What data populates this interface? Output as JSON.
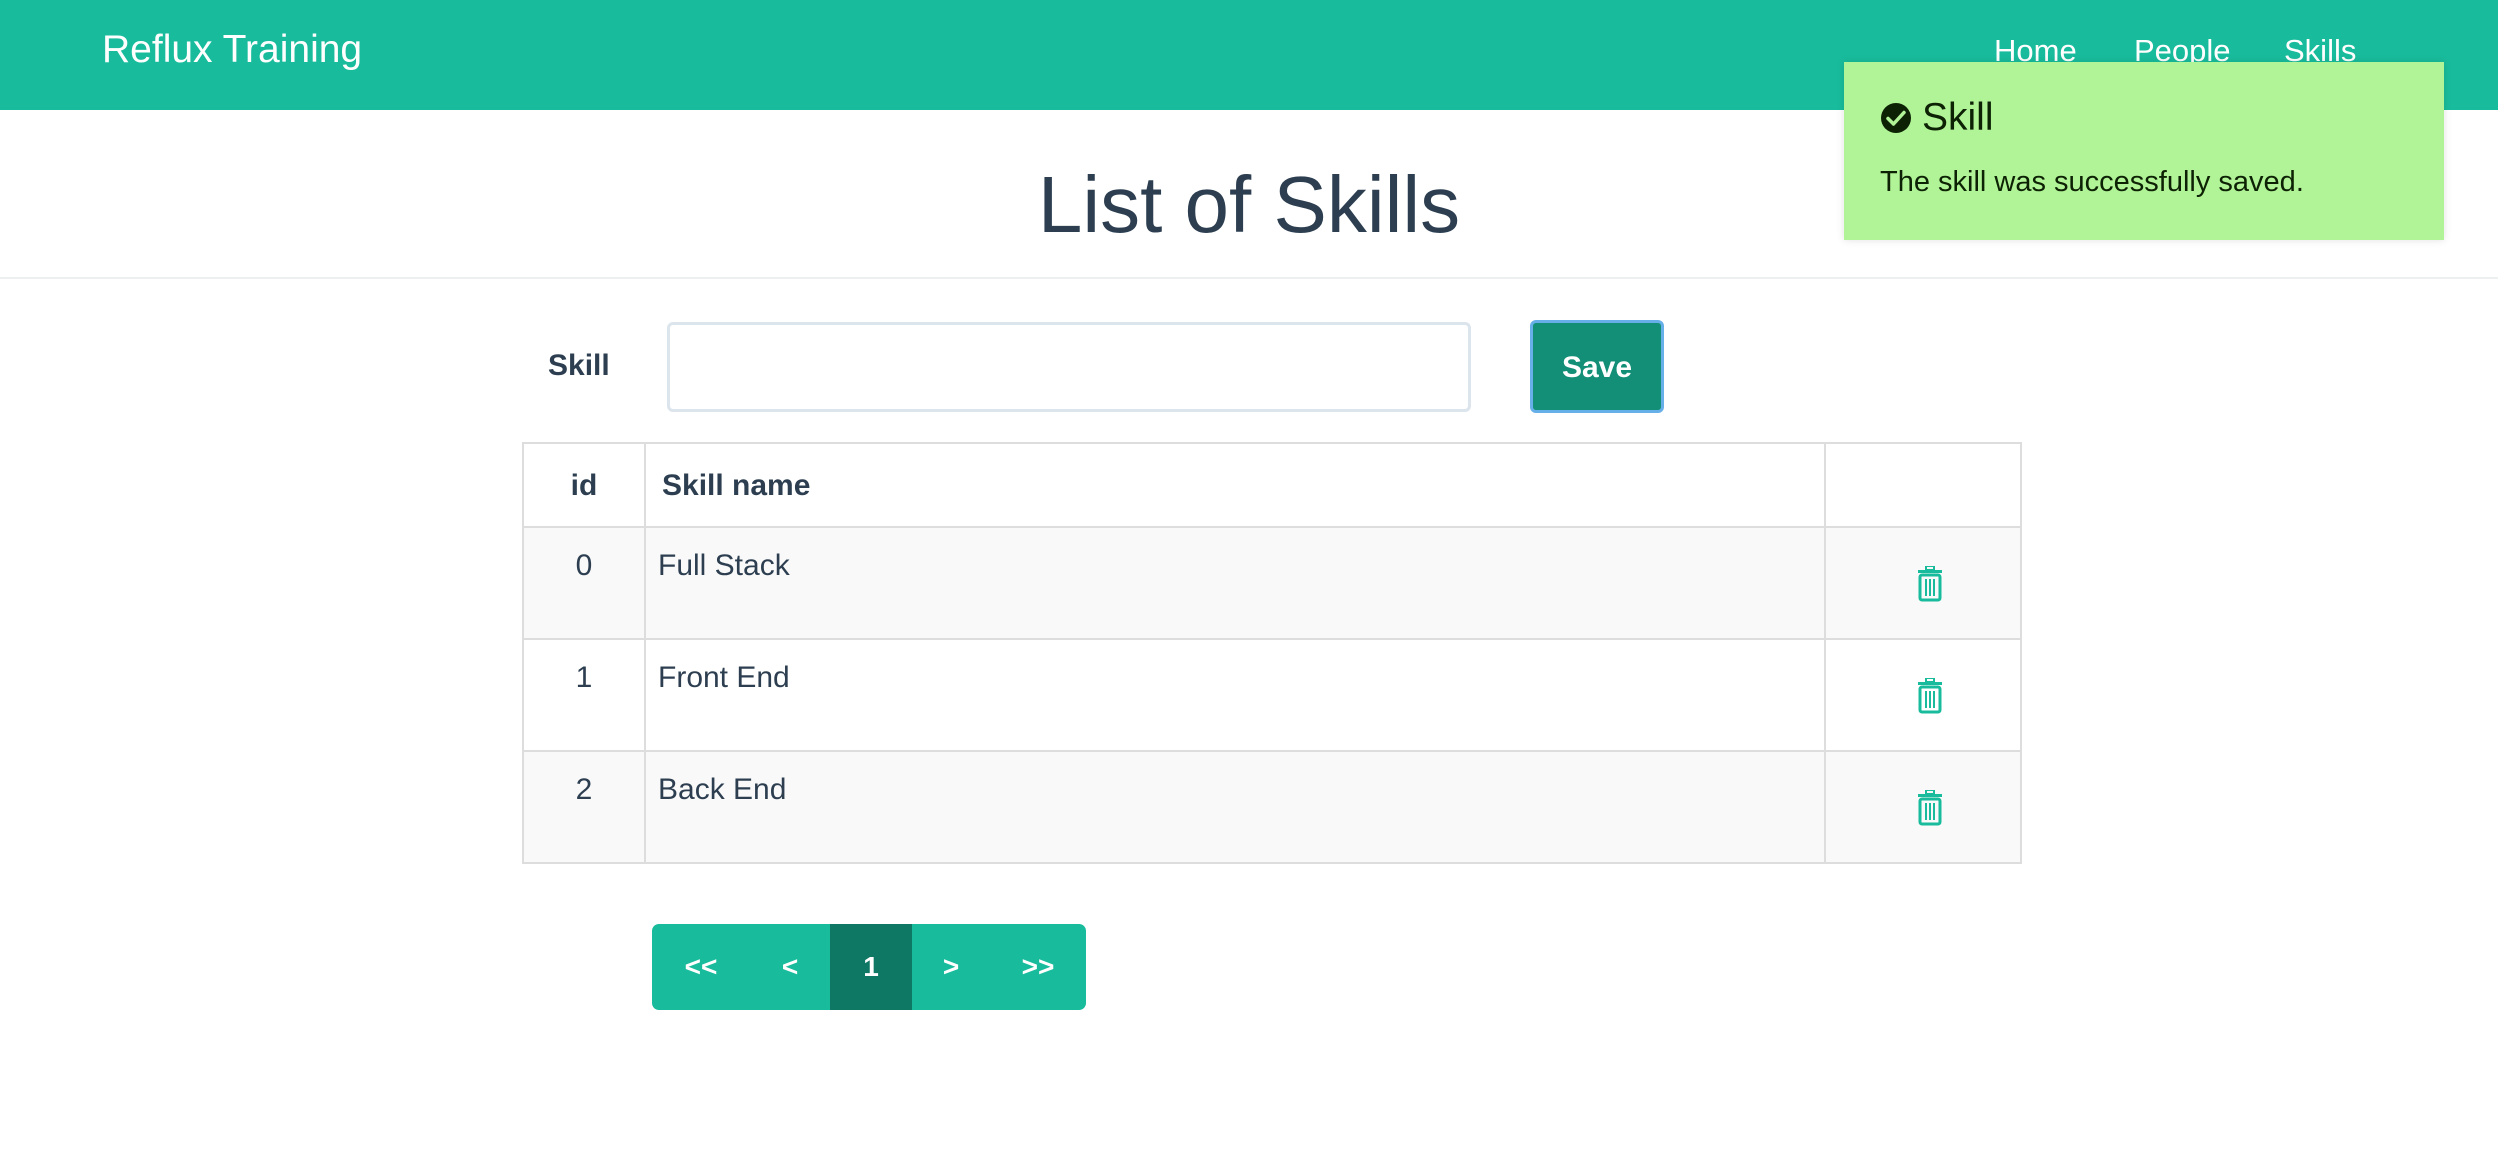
{
  "navbar": {
    "brand": "Reflux Training",
    "links": [
      "Home",
      "People",
      "Skills"
    ]
  },
  "header": {
    "title": "List of Skills"
  },
  "form": {
    "label": "Skill",
    "input_value": "",
    "input_placeholder": "",
    "save_label": "Save"
  },
  "table": {
    "headers": [
      "id",
      "Skill name",
      ""
    ],
    "rows": [
      {
        "id": "0",
        "name": "Full Stack"
      },
      {
        "id": "1",
        "name": "Front End"
      },
      {
        "id": "2",
        "name": "Back End"
      }
    ],
    "action_icon": "trash-icon"
  },
  "pagination": {
    "first": "<<",
    "prev": "<",
    "current": "1",
    "next": ">",
    "last": ">>"
  },
  "toast": {
    "icon": "check-circle-icon",
    "title": "Skill",
    "message": "The skill was successfully saved."
  },
  "colors": {
    "primary": "#18bc9c",
    "save_button": "#128f76",
    "active_page": "#0f7864",
    "toast_bg": "#b1f397",
    "text": "#2c3e50"
  }
}
